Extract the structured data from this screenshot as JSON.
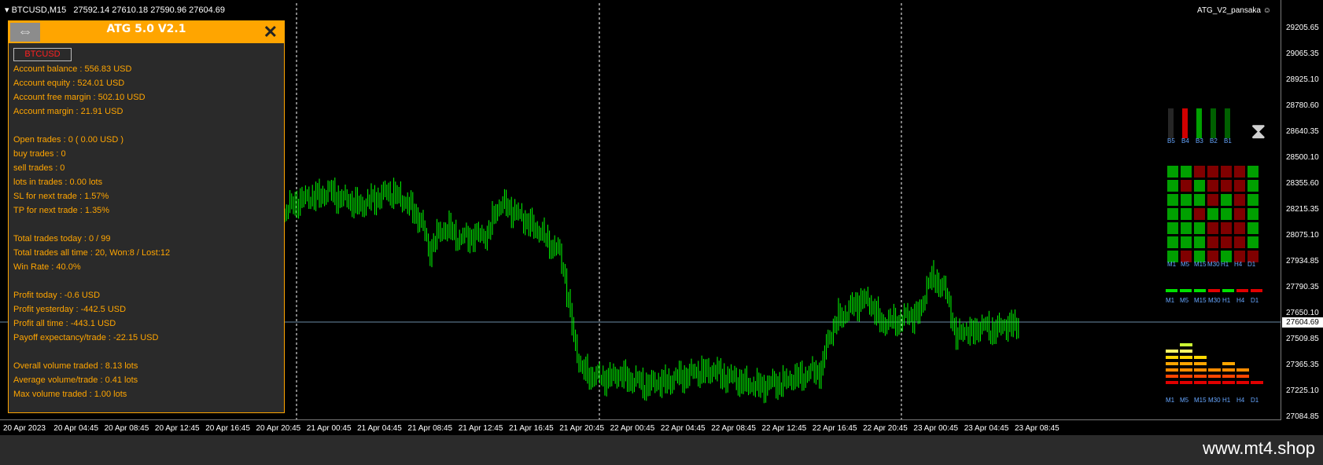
{
  "chart": {
    "symbol": "BTCUSD,M15",
    "ohlc": "27592.14 27610.18 27590.96 27604.69",
    "indicator_name": "ATG_V2_pansaka",
    "indicator_icon": "smiley-icon",
    "current_price": "27604.69",
    "price_ticks": [
      "29205.65",
      "29065.35",
      "28925.10",
      "28780.60",
      "28640.35",
      "28500.10",
      "28355.60",
      "28215.35",
      "28075.10",
      "27934.85",
      "27790.35",
      "27650.10",
      "27509.85",
      "27365.35",
      "27225.10",
      "27084.85"
    ],
    "time_ticks": [
      "20 Apr 2023",
      "20 Apr 04:45",
      "20 Apr 08:45",
      "20 Apr 12:45",
      "20 Apr 16:45",
      "20 Apr 20:45",
      "21 Apr 00:45",
      "21 Apr 04:45",
      "21 Apr 08:45",
      "21 Apr 12:45",
      "21 Apr 16:45",
      "21 Apr 20:45",
      "22 Apr 00:45",
      "22 Apr 04:45",
      "22 Apr 08:45",
      "22 Apr 12:45",
      "22 Apr 16:45",
      "22 Apr 20:45",
      "23 Apr 00:45",
      "23 Apr 04:45",
      "23 Apr 08:45"
    ],
    "colors": {
      "background": "#000000",
      "candle": "#00ff00",
      "separator": "#ffffff",
      "price_line": "#6d8ba6"
    }
  },
  "panel": {
    "title": "ATG 5.0 V2.1",
    "move_icon": "move-arrows-icon",
    "move_glyph": "⇔",
    "close_icon": "close-icon",
    "close_glyph": "✕",
    "symbol_button": "BTCUSD",
    "accent": "#ffa500",
    "groups": [
      [
        "Account balance : 556.83 USD",
        "Account equity : 524.01 USD",
        "Account free margin : 502.10 USD",
        "Account margin : 21.91 USD"
      ],
      [
        "Open trades : 0 ( 0.00 USD )",
        "buy trades : 0",
        "sell trades : 0",
        "lots in trades : 0.00 lots",
        "SL for next trade : 1.57%",
        "TP for next trade : 1.35%"
      ],
      [
        "Total trades today : 0 / 99",
        "Total trades all time : 20, Won:8 / Lost:12",
        "Win Rate : 40.0%"
      ],
      [
        "Profit today : -0.6 USD",
        "Profit yesterday : -442.5 USD",
        "Profit all time : -443.1 USD",
        "Payoff expectancy/trade : -22.15 USD"
      ],
      [
        "Overall volume traded : 8.13 lots",
        "Average volume/trade : 0.41 lots",
        "Max volume traded : 1.00 lots"
      ]
    ]
  },
  "side_widgets": {
    "bar_labels": [
      "B5",
      "B4",
      "B3",
      "B2",
      "B1"
    ],
    "bar_colors": [
      "#262626",
      "#d00000",
      "#00a000",
      "#006000",
      "#006000"
    ],
    "hourglass_icon": "hourglass-icon",
    "tf_labels": [
      "M1",
      "M5",
      "M15",
      "M30",
      "H1",
      "H4",
      "D1"
    ],
    "grid": [
      [
        "g",
        "g",
        "r",
        "r",
        "r",
        "r",
        "g"
      ],
      [
        "g",
        "r",
        "g",
        "r",
        "r",
        "r",
        "g"
      ],
      [
        "g",
        "g",
        "g",
        "r",
        "g",
        "r",
        "g"
      ],
      [
        "g",
        "g",
        "r",
        "g",
        "g",
        "r",
        "g"
      ],
      [
        "g",
        "g",
        "g",
        "r",
        "r",
        "r",
        "g"
      ],
      [
        "g",
        "g",
        "g",
        "r",
        "r",
        "r",
        "g"
      ],
      [
        "g",
        "r",
        "g",
        "r",
        "g",
        "r",
        "r"
      ]
    ],
    "trend_colors": [
      "#00e000",
      "#00e000",
      "#00e000",
      "#e00000",
      "#00e000",
      "#e00000",
      "#e00000"
    ],
    "volume_levels": [
      5,
      6,
      4,
      2,
      3,
      2,
      0
    ]
  },
  "watermark": "www.mt4.shop"
}
